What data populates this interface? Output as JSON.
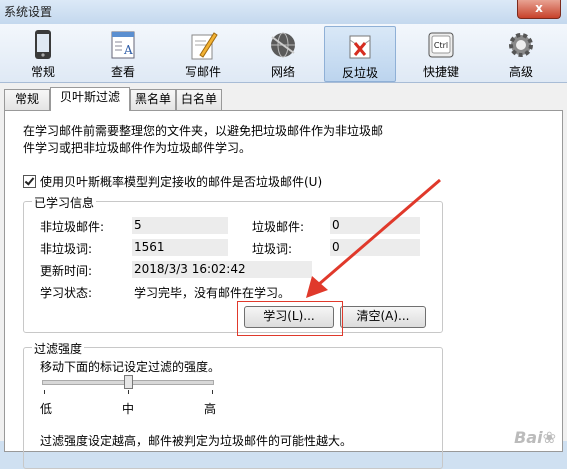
{
  "window": {
    "title": "系统设置",
    "close_label": "x"
  },
  "toolbar": {
    "items": [
      {
        "label": "常规",
        "icon": "phone-icon"
      },
      {
        "label": "查看",
        "icon": "view-icon"
      },
      {
        "label": "写邮件",
        "icon": "pencil-icon"
      },
      {
        "label": "网络",
        "icon": "globe-icon"
      },
      {
        "label": "反垃圾",
        "icon": "antispam-icon",
        "active": true
      },
      {
        "label": "快捷键",
        "icon": "ctrl-key-icon"
      },
      {
        "label": "高级",
        "icon": "gear-icon"
      }
    ],
    "ctrl_text": "Ctrl"
  },
  "tabs": [
    {
      "label": "常规"
    },
    {
      "label": "贝叶斯过滤",
      "selected": true
    },
    {
      "label": "黑名单"
    },
    {
      "label": "白名单"
    }
  ],
  "bayes": {
    "description_line1": "在学习邮件前需要整理您的文件夹，以避免把垃圾邮件作为非垃圾邮",
    "description_line2": "件学习或把非垃圾邮件作为垃圾邮件学习。",
    "use_model_label": "使用贝叶斯概率模型判定接收的邮件是否垃圾邮件(U)",
    "use_model_checked": true,
    "learned": {
      "legend": "已学习信息",
      "nonspam_mail_label": "非垃圾邮件:",
      "nonspam_mail_value": "5",
      "spam_mail_label": "垃圾邮件:",
      "spam_mail_value": "0",
      "nonspam_words_label": "非垃圾词:",
      "nonspam_words_value": "1561",
      "spam_words_label": "垃圾词:",
      "spam_words_value": "0",
      "update_time_label": "更新时间:",
      "update_time_value": "2018/3/3 16:02:42",
      "status_label": "学习状态:",
      "status_value": "学习完毕，没有邮件在学习。",
      "learn_button": "学习(L)...",
      "clear_button": "清空(A)..."
    },
    "strength": {
      "legend": "过滤强度",
      "instruction": "移动下面的标记设定过滤的强度。",
      "low": "低",
      "mid": "中",
      "high": "高",
      "level": 0.5,
      "note": "过滤强度设定越高，邮件被判定为垃圾邮件的可能性越大。"
    }
  },
  "colors": {
    "annotation": "#e0392b",
    "active_tab": "#bcd4ee"
  }
}
